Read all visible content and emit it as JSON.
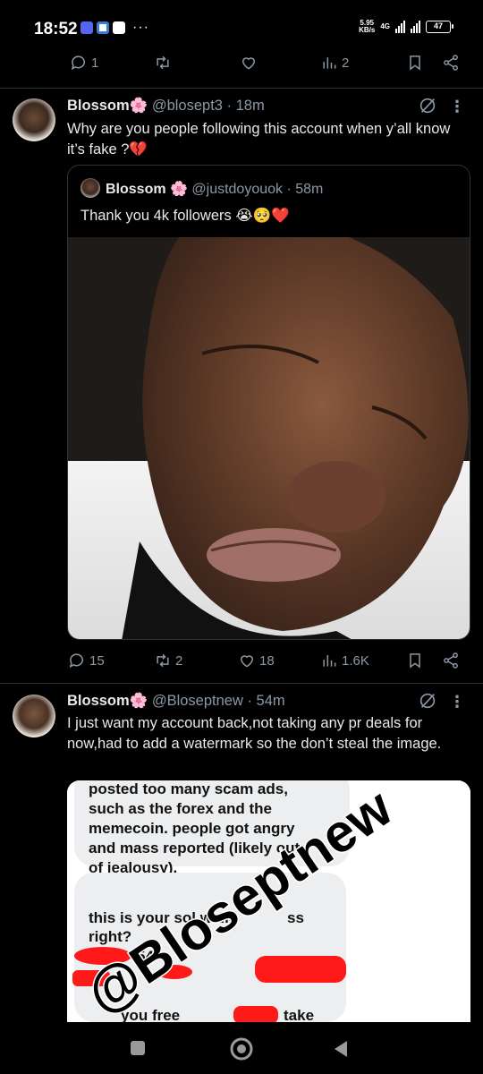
{
  "status_bar": {
    "time": "18:52",
    "more_indicator": "···",
    "speed_value": "5.95",
    "speed_unit": "KB/s",
    "network": "4G",
    "battery": "47"
  },
  "top_actions": {
    "replies": "1",
    "views": "2"
  },
  "tweet1": {
    "name": "Blossom🌸",
    "handle": "@blosept3",
    "time": " · 18m",
    "text": "Why are you people following this account when y’all know it’s fake ?💔",
    "quote": {
      "name": "Blossom 🌸",
      "handle": "@justdoyouok",
      "time": " · 58m",
      "text": "Thank you 4k followers 😭🥺❤️"
    },
    "actions": {
      "replies": "15",
      "reposts": "2",
      "likes": "18",
      "views": "1.6K"
    }
  },
  "tweet2": {
    "name": "Blossom🌸",
    "handle": "@Bloseptnew",
    "time": " · 54m",
    "text": "I just want my account back,not taking any pr deals for now,had to add a watermark so the don’t steal the image.",
    "image": {
      "bubble1_lines": [
        "posted too many scam ads,",
        "such as the forex and the",
        "memecoin. people got angry",
        "and mass reported (likely out",
        "of jealousy)."
      ],
      "bubble2_lines": [
        "this is your sol walle",
        "right?"
      ],
      "bubble2_suffix": "ss",
      "fragment1": "54",
      "fragment2": "you free",
      "fragment3": "take",
      "watermark": "@Bloseptnew"
    }
  },
  "icons": {
    "reply": "reply-icon",
    "repost": "repost-icon",
    "like": "heart-icon",
    "views": "views-icon",
    "bookmark": "bookmark-icon",
    "share": "share-icon",
    "grok": "grok-icon",
    "more": "more-icon"
  },
  "colors": {
    "background": "#000000",
    "text": "#e7e9ea",
    "muted": "#8b98a5",
    "divider": "#2f3336",
    "censor": "#ff1a1a"
  }
}
